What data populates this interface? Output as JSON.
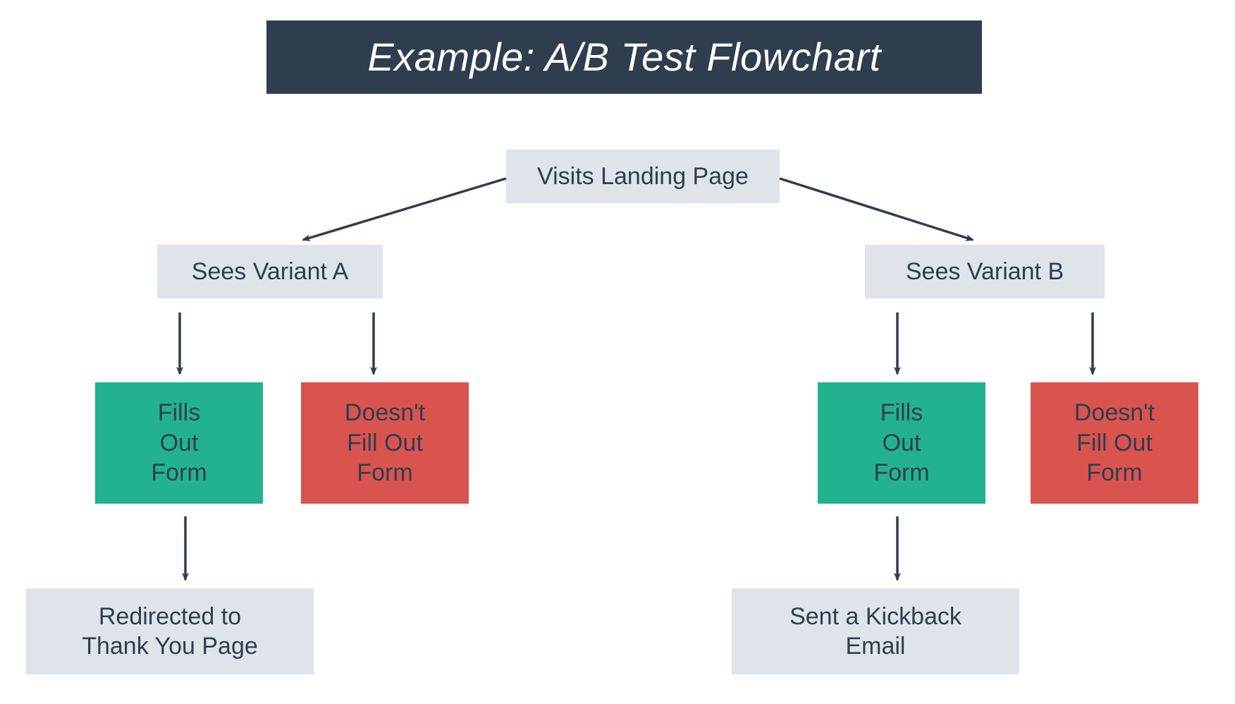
{
  "title": "Example: A/B Test Flowchart",
  "nodes": {
    "start": "Visits Landing Page",
    "variantA": "Sees Variant A",
    "variantB": "Sees Variant B",
    "fillsA": "Fills\nOut\nForm",
    "nofillA": "Doesn't\nFill Out\nForm",
    "fillsB": "Fills\nOut\nForm",
    "nofillB": "Doesn't\nFill Out\nForm",
    "thankyou": "Redirected to\nThank You Page",
    "kickback": "Sent a Kickback\nEmail"
  }
}
